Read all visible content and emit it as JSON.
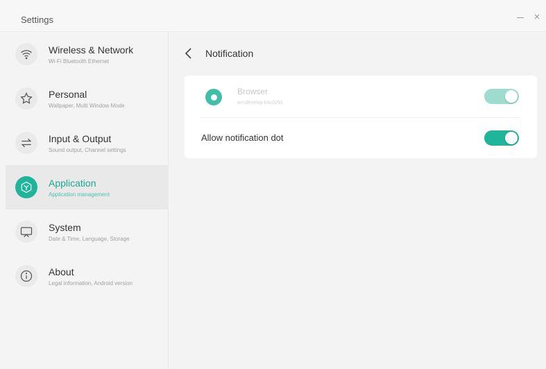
{
  "window": {
    "title": "Settings",
    "minimize_label": "",
    "close_label": "×"
  },
  "sidebar": {
    "items": [
      {
        "title": "Wireless & Network",
        "subtitle": "Wi-Fi Bluetooth Ethernet",
        "icon": "wifi-icon"
      },
      {
        "title": "Personal",
        "subtitle": "Wallpaper, Multi Window Mode",
        "icon": "star-icon"
      },
      {
        "title": "Input & Output",
        "subtitle": "Sound output, Channel settings",
        "icon": "swap-arrows-icon"
      },
      {
        "title": "Application",
        "subtitle": "Application management",
        "icon": "application-cube-icon",
        "active": true
      },
      {
        "title": "System",
        "subtitle": "Date & Time, Language, Storage",
        "icon": "monitor-icon"
      },
      {
        "title": "About",
        "subtitle": "Legal information, Android version",
        "icon": "info-icon"
      }
    ]
  },
  "main": {
    "title": "Notification",
    "app": {
      "name": "Browser",
      "package": "am-develop-b4c0291",
      "toggle_on": true,
      "toggle_disabled": true
    },
    "allow_dot": {
      "label": "Allow notification dot",
      "toggle_on": true
    }
  },
  "colors": {
    "accent": "#1fb59a",
    "accent_disabled": "#9ddccf"
  }
}
